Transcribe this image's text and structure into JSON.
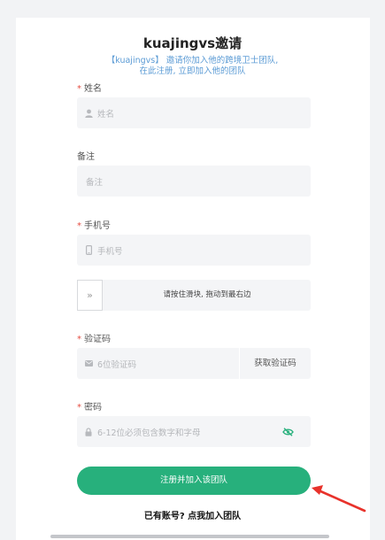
{
  "header": {
    "title": "kuajingvs邀请",
    "subtitle_line1": "【kuajingvs】 邀请你加入他的跨境卫士团队,",
    "subtitle_line2": "在此注册, 立即加入他的团队"
  },
  "form": {
    "required_mark": "*",
    "name": {
      "label": "姓名",
      "placeholder": "姓名",
      "icon": "user-icon"
    },
    "remark": {
      "label": "备注",
      "placeholder": "备注"
    },
    "phone": {
      "label": "手机号",
      "placeholder": "手机号",
      "icon": "mobile-icon"
    },
    "slider": {
      "text": "请按住滑块, 拖动到最右边",
      "handle_glyph": "»"
    },
    "code": {
      "label": "验证码",
      "placeholder": "6位验证码",
      "button": "获取验证码",
      "icon": "mail-icon"
    },
    "password": {
      "label": "密码",
      "placeholder": "6-12位必须包含数字和字母",
      "icon": "lock-icon",
      "toggle_icon": "eye-off-icon"
    },
    "submit": "注册并加入该团队",
    "login_link": "已有账号? 点我加入团队"
  },
  "colors": {
    "primary": "#27b07c",
    "required": "#e54d42",
    "subtitle": "#5b9bd5",
    "annotation": "#e8322b"
  }
}
